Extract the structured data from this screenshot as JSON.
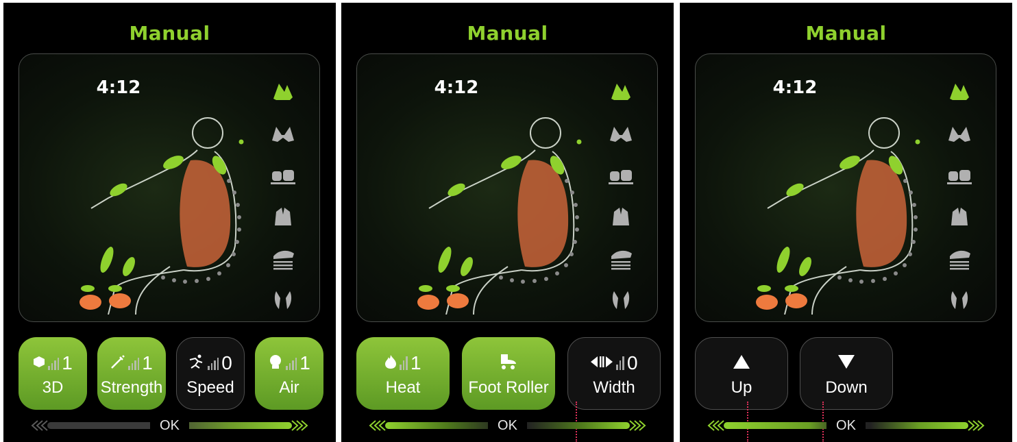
{
  "colors": {
    "accent": "#8fd12e",
    "button_on": "#7cba32",
    "button_off": "#121212"
  },
  "panels": [
    {
      "title": "Manual",
      "timer": "4:12",
      "mode_icons": [
        "knead-hands-icon",
        "tap-hands-icon",
        "clap-hands-icon",
        "shiatsu-hands-icon",
        "roll-palm-icon",
        "foot-press-icon"
      ],
      "buttons": [
        {
          "label": "3D",
          "value": "1",
          "icon": "cube-icon",
          "active": true
        },
        {
          "label": "Strength",
          "value": "1",
          "icon": "syringe-icon",
          "active": true
        },
        {
          "label": "Speed",
          "value": "0",
          "icon": "runner-icon",
          "active": false
        },
        {
          "label": "Air",
          "value": "1",
          "icon": "airbag-icon",
          "active": true
        }
      ],
      "ok_label": "OK"
    },
    {
      "title": "Manual",
      "timer": "4:12",
      "mode_icons": [
        "knead-hands-icon",
        "tap-hands-icon",
        "clap-hands-icon",
        "shiatsu-hands-icon",
        "roll-palm-icon",
        "foot-press-icon"
      ],
      "buttons": [
        {
          "label": "Heat",
          "value": "1",
          "icon": "flame-icon",
          "active": true
        },
        {
          "label": "Foot Roller",
          "value": "",
          "icon": "skate-icon",
          "active": true
        },
        {
          "label": "Width",
          "value": "0",
          "icon": "width-icon",
          "active": false
        }
      ],
      "ok_label": "OK"
    },
    {
      "title": "Manual",
      "timer": "4:12",
      "mode_icons": [
        "knead-hands-icon",
        "tap-hands-icon",
        "clap-hands-icon",
        "shiatsu-hands-icon",
        "roll-palm-icon",
        "foot-press-icon"
      ],
      "buttons": [
        {
          "label": "Up",
          "value": "",
          "icon": "triangle-up-icon",
          "active": false
        },
        {
          "label": "Down",
          "value": "",
          "icon": "triangle-down-icon",
          "active": false
        }
      ],
      "ok_label": "OK"
    }
  ]
}
